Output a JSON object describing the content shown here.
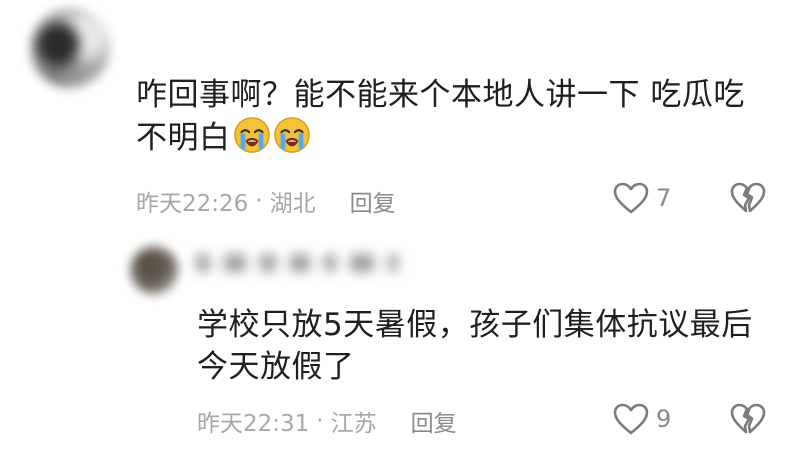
{
  "comments": [
    {
      "text": "咋回事啊？能不能来个本地人讲一下 吃瓜吃不明白",
      "emoji": "crying-face",
      "emoji_count": 2,
      "time": "昨天22:26",
      "separator": "·",
      "location": "湖北",
      "reply_label": "回复",
      "likes": "7"
    },
    {
      "text": "学校只放5天暑假，孩子们集体抗议最后今天放假了",
      "time": "昨天22:31",
      "separator": "·",
      "location": "江苏",
      "reply_label": "回复",
      "likes": "9"
    }
  ],
  "colors": {
    "text": "#1f1f1f",
    "meta": "#a7a7a7",
    "icon": "#7b7b7b",
    "emoji_face": "#f5c338",
    "emoji_tears": "#5aa9f0"
  }
}
